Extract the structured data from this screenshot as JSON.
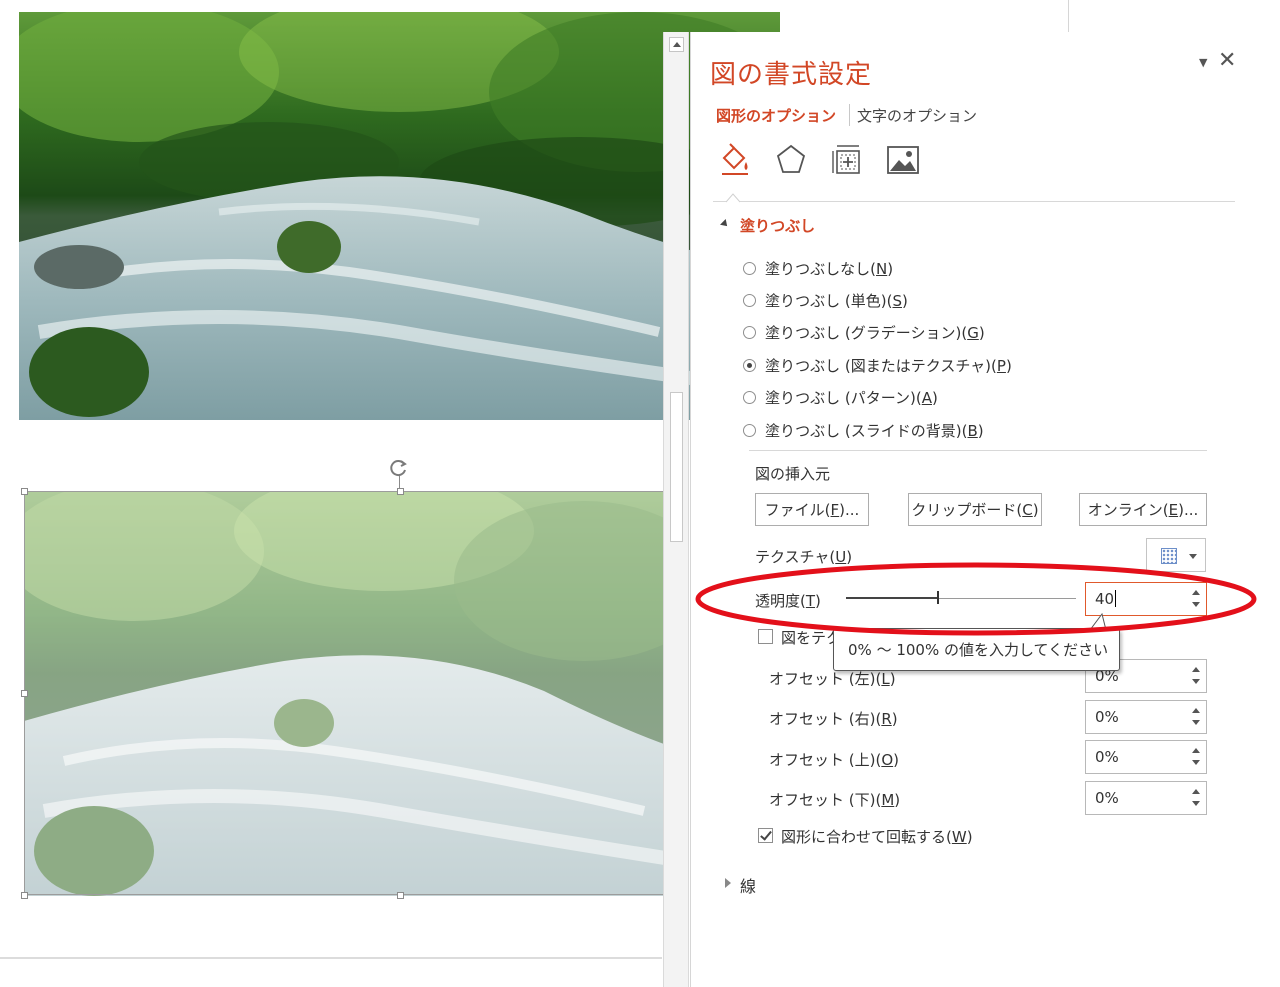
{
  "pane": {
    "title": "図の書式設定",
    "menu_glyph": "▼",
    "close_glyph": "✕",
    "tabs": {
      "shape_options": "図形のオプション",
      "text_options": "文字のオプション"
    },
    "icon_tabs": [
      "fill-and-line-icon",
      "effects-icon",
      "size-and-properties-icon",
      "picture-icon"
    ],
    "fill_section": {
      "title": "塗りつぶし",
      "radios": [
        {
          "label": "塗りつぶしなし(N)",
          "selected": false
        },
        {
          "label": "塗りつぶし (単色)(S)",
          "selected": false
        },
        {
          "label": "塗りつぶし (グラデーション)(G)",
          "selected": false
        },
        {
          "label": "塗りつぶし (図またはテクスチャ)(P)",
          "selected": true
        },
        {
          "label": "塗りつぶし (パターン)(A)",
          "selected": false
        },
        {
          "label": "塗りつぶし (スライドの背景)(B)",
          "selected": false
        }
      ],
      "insert_from_label": "図の挿入元",
      "buttons": {
        "file": "ファイル(F)...",
        "clipboard": "クリップボード(C)",
        "online": "オンライン(E)..."
      },
      "texture_label": "テクスチャ(U)",
      "transparency_label": "透明度(T)",
      "transparency_value": "40",
      "transparency_percent": 40,
      "tile_checkbox_label": "図をテク",
      "tile_checked": false,
      "offsets": [
        {
          "label": "オフセット (左)(L)",
          "value": "0%"
        },
        {
          "label": "オフセット (右)(R)",
          "value": "0%"
        },
        {
          "label": "オフセット (上)(O)",
          "value": "0%"
        },
        {
          "label": "オフセット (下)(M)",
          "value": "0%"
        }
      ],
      "rotate_checkbox_label": "図形に合わせて回転する(W)",
      "rotate_checked": true
    },
    "line_section": {
      "title": "線"
    }
  },
  "tooltip": {
    "text": "0% ～ 100% の値を入力してください"
  },
  "colors": {
    "accent": "#d24726",
    "highlight_ellipse": "#e3101a"
  }
}
